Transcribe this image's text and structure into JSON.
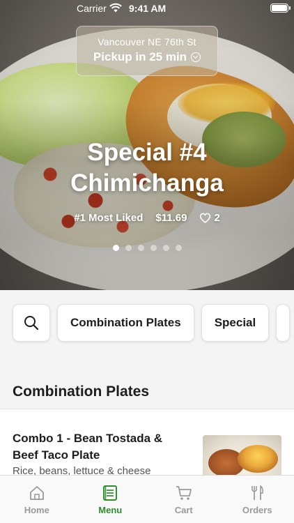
{
  "status_bar": {
    "carrier": "Carrier",
    "time": "9:41 AM"
  },
  "location": {
    "city": "Vancouver NE 76th St",
    "pickup": "Pickup in 25 min"
  },
  "hero": {
    "title_line1": "Special #4",
    "title_line2": "Chimichanga",
    "badge": "#1 Most Liked",
    "price": "$11.69",
    "likes": "2",
    "slide_count": 6,
    "active_slide": 0
  },
  "categories": {
    "items": [
      "Combination Plates",
      "Special"
    ]
  },
  "section": {
    "title": "Combination Plates"
  },
  "menu_item": {
    "name": "Combo 1 - Bean Tostada & Beef Taco Plate",
    "description": "Rice, beans, lettuce & cheese"
  },
  "tabbar": {
    "items": [
      {
        "label": "Home",
        "icon": "home-icon"
      },
      {
        "label": "Menu",
        "icon": "menu-icon"
      },
      {
        "label": "Cart",
        "icon": "cart-icon"
      },
      {
        "label": "Orders",
        "icon": "orders-icon"
      }
    ],
    "active": "Menu"
  },
  "colors": {
    "accent": "#2e8b2e",
    "inactive_tab": "#9a9a9a",
    "background": "#f4f4f4"
  }
}
